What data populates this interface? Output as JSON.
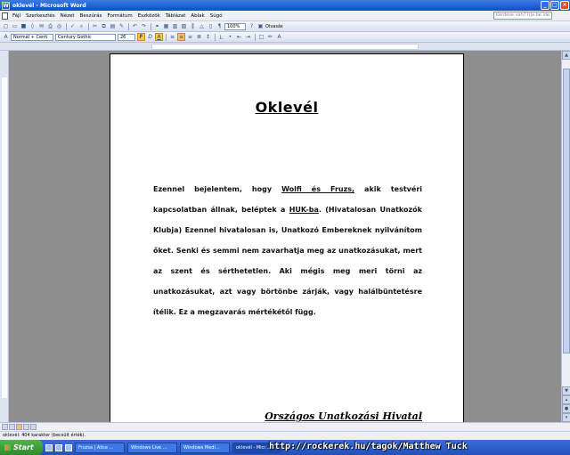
{
  "window": {
    "title": "oklevél - Microsoft Word"
  },
  "menu": {
    "items": [
      "Fájl",
      "Szerkesztés",
      "Nézet",
      "Beszúrás",
      "Formátum",
      "Eszközök",
      "Táblázat",
      "Ablak",
      "Súgó"
    ],
    "help_placeholder": "Kérdése van? Írja be ide."
  },
  "toolbar": {
    "reading_label": "Olvasás",
    "style": "Normál + Centi",
    "font": "Century Gothic",
    "size": "26"
  },
  "document": {
    "title": "Oklevél",
    "body_before": "Ezennel bejelentem, hogy ",
    "name": "Wolfi és Fruzs,",
    "body_mid": " akik testvéri kapcsolatban állnak, beléptek a ",
    "club_abbr": "HUK-ba",
    "body_after": ". (Hivatalosan Unatkozók Klubja) Ezennel hivatalosan is, Unatkozó Embereknek nyilvánítom őket. Senki és semmi nem zavarhatja meg az unatkozásukat, mert az szent és sérthetetlen. Aki mégis meg meri törni az unatkozásukat, azt vagy börtönbe zárják, vagy halálbüntetésre ítélik. Ez a megzavarás mértékétől függ.",
    "signature": "Országos Unatkozási Hivatal"
  },
  "status": {
    "text": "oklevél: 404 karakter (becsült érték)."
  },
  "taskbar": {
    "start_label": "Start",
    "tasks": [
      "Fruzsa | Alice ...",
      "Windows Live ...",
      "Windows Medi...",
      "oklevél - Micr..."
    ]
  },
  "watermark": "http://rockerek.hu/tagok/Matthew Tuck"
}
